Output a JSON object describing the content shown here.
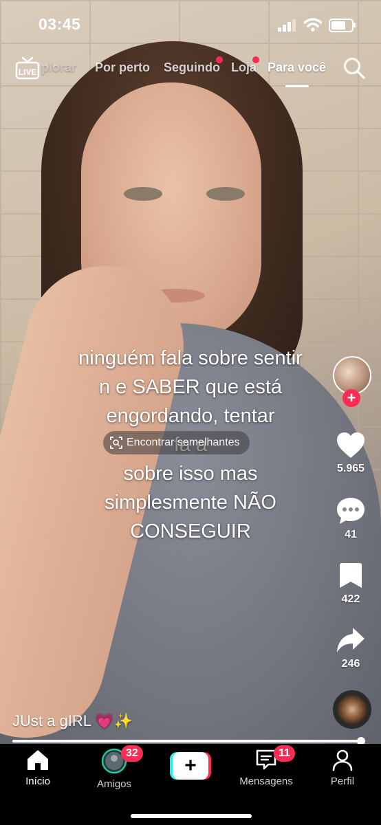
{
  "status_bar": {
    "time": "03:45"
  },
  "top_nav": {
    "live_label": "LIVE",
    "tabs": [
      {
        "label": "Explorar",
        "shown_text": "plorar"
      },
      {
        "label": "Por perto"
      },
      {
        "label": "Seguindo",
        "has_dot": true
      },
      {
        "label": "Loja",
        "has_dot": true
      },
      {
        "label": "Para você",
        "active": true
      }
    ]
  },
  "video": {
    "caption": "ninguém fala sobre sentir\nn e SABER que está\nengordando, tentar\nfa        a\nsobre isso mas\nsimplesmente NÃO\nCONSEGUIR",
    "find_similar": "Encontrar semelhantes",
    "username": "JUst a gIRL 💗✨",
    "progress": 0.99
  },
  "actions": {
    "likes": "5.965",
    "comments": "41",
    "saves": "422",
    "shares": "246"
  },
  "bottom_nav": {
    "items": [
      {
        "label": "Início",
        "active": true
      },
      {
        "label": "Amigos",
        "badge": "32"
      },
      {
        "label": ""
      },
      {
        "label": "Mensagens",
        "badge": "11"
      },
      {
        "label": "Perfil"
      }
    ]
  },
  "colors": {
    "accent": "#fe2c55",
    "cyan": "#25f4ee"
  },
  "icons": [
    "live-icon",
    "search-icon",
    "find-similar-icon",
    "heart-icon",
    "comment-icon",
    "bookmark-icon",
    "share-icon",
    "home-icon",
    "friends-avatar-icon",
    "plus-icon",
    "inbox-icon",
    "profile-icon"
  ]
}
